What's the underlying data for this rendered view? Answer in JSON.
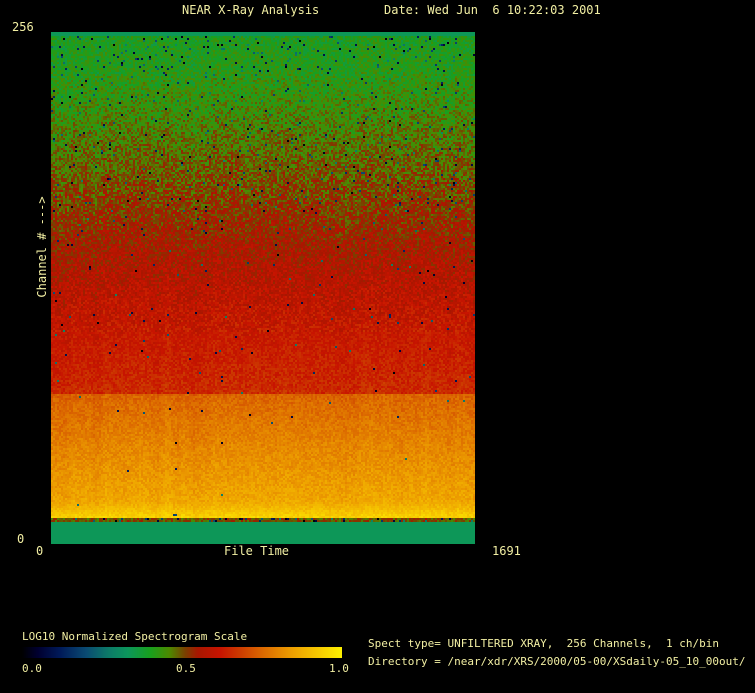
{
  "header": {
    "title": "NEAR X-Ray Analysis",
    "date": "Date: Wed Jun  6 10:22:03 2001"
  },
  "plot": {
    "y_max_label": "256",
    "y_min_label": "0",
    "y_axis_label": "Channel # --->",
    "x_min_label": "0",
    "x_axis_label": "File Time",
    "x_max_label": "1691"
  },
  "legend": {
    "title": "LOG10 Normalized Spectrogram Scale",
    "ticks": [
      "0.0",
      "0.5",
      "1.0"
    ]
  },
  "info": {
    "spect_type": "Spect type= UNFILTERED XRAY,  256 Channels,  1 ch/bin",
    "directory": "Directory = /near/xdr/XRS/2000/05-00/XSdaily-05_10_00out/"
  },
  "colors": {
    "background": "#000000",
    "text": "#f2efa3",
    "solid_band_green": "#0c965c"
  },
  "chart_data": {
    "type": "heatmap",
    "title": "NEAR X-Ray Analysis",
    "xlabel": "File Time",
    "ylabel": "Channel #",
    "xlim": [
      0,
      1691
    ],
    "ylim": [
      0,
      256
    ],
    "grid": false,
    "colorbar_label": "LOG10 Normalized Spectrogram Scale",
    "colorbar_range": [
      0.0,
      1.0
    ],
    "colorbar_ticks": [
      0.0,
      0.5,
      1.0
    ],
    "legend_position": "bottom-left",
    "channels": 256,
    "ch_per_bin": 1,
    "value_profile_by_channel": [
      {
        "channels": [
          254,
          256
        ],
        "value_at_ch_min": 0.335,
        "value_at_ch_max": 0.335,
        "appearance": "solid sea-green band"
      },
      {
        "channels": [
          236,
          254
        ],
        "value_at_ch_min": 0.415,
        "value_at_ch_max": 0.4,
        "appearance": "green noise with dark dropouts"
      },
      {
        "channels": [
          156,
          236
        ],
        "value_at_ch_min": 0.54,
        "value_at_ch_max": 0.415,
        "appearance": "green-to-red speckled transition"
      },
      {
        "channels": [
          106,
          156
        ],
        "value_at_ch_min": 0.62,
        "value_at_ch_max": 0.54,
        "appearance": "red with green speckles"
      },
      {
        "channels": [
          75,
          106
        ],
        "value_at_ch_min": 0.655,
        "value_at_ch_max": 0.62,
        "appearance": "saturated red-orange noise"
      },
      {
        "channels": [
          13,
          75
        ],
        "value_at_ch_min": 0.945,
        "value_at_ch_max": 0.745,
        "appearance": "orange brightening to yellow toward low channels"
      },
      {
        "channels": [
          11,
          13
        ],
        "value_at_ch_min": 0.5,
        "value_at_ch_max": 0.5,
        "appearance": "dark brown separator line with black ticks"
      },
      {
        "channels": [
          0,
          11
        ],
        "value_at_ch_min": 0.335,
        "value_at_ch_max": 0.335,
        "appearance": "solid sea-green band"
      }
    ]
  },
  "spectrogram_render": {
    "seed": 1234567,
    "grid": [
      212,
      256
    ],
    "colormap": [
      [
        0.0,
        "#000000"
      ],
      [
        0.05,
        "#000030"
      ],
      [
        0.12,
        "#001a59"
      ],
      [
        0.2,
        "#0a4a72"
      ],
      [
        0.27,
        "#0c7a68"
      ],
      [
        0.33,
        "#0c965c"
      ],
      [
        0.4,
        "#18a01e"
      ],
      [
        0.46,
        "#4c8a00"
      ],
      [
        0.51,
        "#7a4000"
      ],
      [
        0.55,
        "#a81600"
      ],
      [
        0.62,
        "#c81400"
      ],
      [
        0.68,
        "#cc3a00"
      ],
      [
        0.76,
        "#dd6d00"
      ],
      [
        0.85,
        "#eea200"
      ],
      [
        0.93,
        "#f7cb00"
      ],
      [
        1.0,
        "#fdf100"
      ]
    ],
    "bands_top_down": [
      {
        "f0": 0.0,
        "f1": 0.008,
        "v0": 0.335,
        "v1": 0.335,
        "noise": 0,
        "dropout": 0
      },
      {
        "f0": 0.008,
        "f1": 0.078,
        "v0": 0.4,
        "v1": 0.415,
        "noise": 0.045,
        "dropout": 0.045
      },
      {
        "f0": 0.078,
        "f1": 0.39,
        "v0": 0.415,
        "v1": 0.54,
        "noise": 0.055,
        "dropout": 0.022
      },
      {
        "f0": 0.39,
        "f1": 0.586,
        "v0": 0.54,
        "v1": 0.62,
        "noise": 0.05,
        "dropout": 0.007
      },
      {
        "f0": 0.586,
        "f1": 0.707,
        "v0": 0.62,
        "v1": 0.655,
        "noise": 0.035,
        "dropout": 0.003
      },
      {
        "f0": 0.707,
        "f1": 0.918,
        "v0": 0.745,
        "v1": 0.86,
        "noise": 0.03,
        "dropout": 0.002
      },
      {
        "f0": 0.918,
        "f1": 0.949,
        "v0": 0.86,
        "v1": 0.945,
        "noise": 0.025,
        "dropout": 0.002
      },
      {
        "f0": 0.949,
        "f1": 0.956,
        "v0": 0.5,
        "v1": 0.5,
        "noise": 0.04,
        "dropout": 0.12
      },
      {
        "f0": 0.956,
        "f1": 1.001,
        "v0": 0.335,
        "v1": 0.335,
        "noise": 0,
        "dropout": 0
      }
    ]
  }
}
